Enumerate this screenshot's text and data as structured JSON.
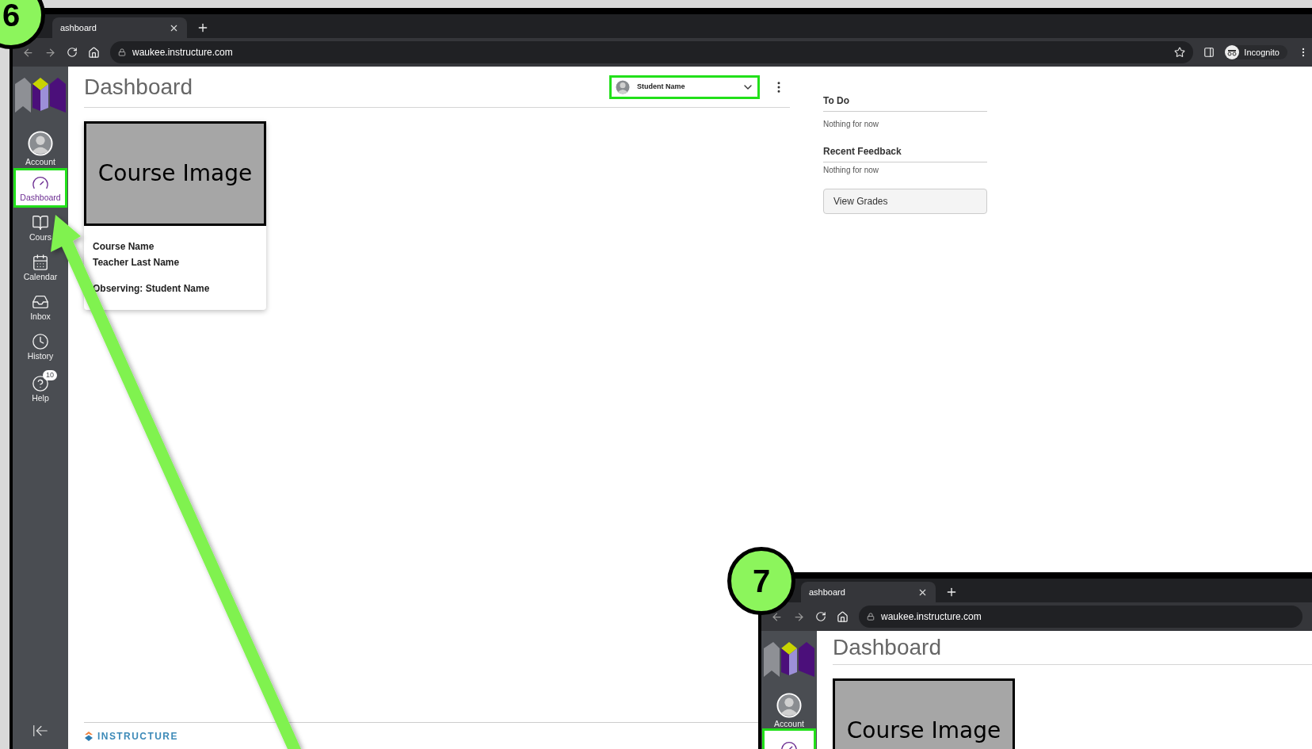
{
  "annotations": [
    {
      "label": "6"
    },
    {
      "label": "7"
    }
  ],
  "windows": [
    {
      "tab": {
        "title": "ashboard"
      },
      "address": "waukee.instructure.com",
      "profile": "Incognito",
      "sidebar": {
        "items": [
          {
            "kind": "account",
            "label": "Account",
            "selected": false
          },
          {
            "kind": "dashboard",
            "label": "Dashboard",
            "selected": true
          },
          {
            "kind": "courses",
            "label": "Cours",
            "selected": false
          },
          {
            "kind": "calendar",
            "label": "Calendar",
            "selected": false
          },
          {
            "kind": "inbox",
            "label": "Inbox",
            "selected": false
          },
          {
            "kind": "history",
            "label": "History",
            "selected": false
          },
          {
            "kind": "help",
            "label": "Help",
            "badge": "10",
            "selected": false
          }
        ]
      },
      "page": {
        "title": "Dashboard",
        "observer": "Student Name",
        "card": {
          "image_label": "Course Image",
          "course": "Course Name",
          "teacher": "Teacher Last Name",
          "observing": "Observing: Student Name"
        },
        "right_panel": {
          "sections": [
            {
              "heading": "To Do",
              "empty": "Nothing for now"
            },
            {
              "heading": "Recent Feedback",
              "empty": "Nothing for now"
            }
          ],
          "button": "View Grades"
        },
        "footer": {
          "logo": "INSTRUCTURE"
        }
      }
    },
    {
      "tab": {
        "title": "ashboard"
      },
      "address": "waukee.instructure.com",
      "sidebar": {
        "items": [
          {
            "kind": "account",
            "label": "Account",
            "selected": false
          },
          {
            "kind": "dashboard",
            "selected": true
          }
        ]
      },
      "page": {
        "title": "Dashboard",
        "card": {
          "image_label": "Course Image"
        }
      }
    }
  ]
}
